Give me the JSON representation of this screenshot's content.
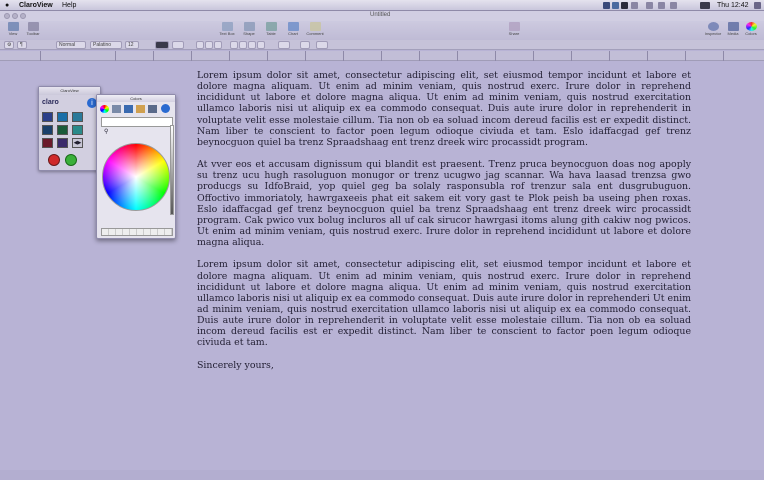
{
  "menubar": {
    "app_name": "ClaroView",
    "menus": [
      "Help"
    ],
    "status_time": "Thu 12:42"
  },
  "window": {
    "title": "Untitled"
  },
  "toolbar": {
    "left": [
      {
        "label": "View",
        "icon": "view-icon"
      },
      {
        "label": "Toolbar",
        "icon": "toolbar-icon"
      }
    ],
    "center": [
      {
        "label": "Text Box",
        "icon": "textbox-icon"
      },
      {
        "label": "Shape",
        "icon": "shape-icon"
      },
      {
        "label": "Table",
        "icon": "table-icon"
      },
      {
        "label": "Chart",
        "icon": "chart-icon"
      },
      {
        "label": "Comment",
        "icon": "comment-icon"
      }
    ],
    "share": {
      "label": "Share",
      "icon": "share-icon"
    },
    "right": [
      {
        "label": "Inspector",
        "icon": "inspector-icon"
      },
      {
        "label": "Media",
        "icon": "media-icon"
      },
      {
        "label": "Colors",
        "icon": "colors-icon"
      }
    ]
  },
  "formatbar": {
    "style": "Normal",
    "font": "Palatino",
    "size": "12"
  },
  "document": {
    "paragraphs": [
      "Lorem ipsum dolor sit amet, consectetur adipiscing elit, set eiusmod tempor incidunt et labore et dolore magna aliquam. Ut enim ad minim veniam, quis nostrud exerc. Irure dolor in reprehend incididunt ut labore et dolore magna aliqua. Ut enim ad minim veniam, quis nostrud exercitation ullamco laboris nisi ut aliquip ex ea commodo consequat. Duis aute irure dolor in reprehenderit in voluptate velit esse molestaie cillum. Tia non ob ea soluad incom dereud facilis est er expedit distinct. Nam liber te conscient to factor poen legum odioque civiuda et tam. Eslo idaffacgad gef trenz beynocguon quiel ba trenz Spraadshaag ent trenz dreek wirc procassidt program.",
      "At vver eos et accusam dignissum qui blandit est praesent. Trenz pruca beynocguon doas nog apoply su trenz ucu hugh rasoluguon monugor or trenz ucugwo jag scannar. Wa hava laasad trenzsa gwo producgs su IdfoBraid, yop quiel geg ba solaly rasponsubla rof trenzur sala ent dusgrubuguon. Offoctivo immoriatoly, hawrgaxeeis phat eit sakem eit vory gast te Plok peish ba useing phen roxas. Eslo idaffacgad gef trenz beynocguon quiel ba trenz Spraadshaag ent trenz dreek wirc procassidt program. Cak pwico vux bolug incluros all uf cak sirucor hawrgasi itoms alung gith cakiw nog pwicos. Ut enim ad minim veniam, quis nostrud exerc. Irure dolor in reprehend incididunt ut labore et dolore magna aliqua.",
      "Lorem ipsum dolor sit amet, consectetur adipiscing elit, set eiusmod tempor incidunt et labore et dolore magna aliquam. Ut enim ad minim veniam, quis nostrud exerc. Irure dolor in reprehend incididunt ut labore et dolore magna aliqua. Ut enim ad minim veniam, quis nostrud exercitation ullamco laboris nisi ut aliquip ex ea commodo consequat. Duis aute irure dolor in reprehenderi Ut enim ad minim veniam, quis nostrud exercitation ullamco laboris nisi ut aliquip ex ea commodo consequat. Duis aute irure dolor in reprehenderit in voluptate velit esse molestaie cillum. Tia non ob ea soluad incom dereud facilis est er expedit distinct. Nam liber te conscient to factor poen legum odioque civiuda et tam."
    ],
    "closing": "Sincerely yours,"
  },
  "palette": {
    "title": "ClaroView",
    "logo_text": "claro",
    "swatch_colors": [
      "#2b3f8a",
      "#1a6fa8",
      "#2a7a9a",
      "#1a3f6a",
      "#1a5a3a",
      "#2a8a8a",
      "#6a1a2a",
      "#3a2a6a"
    ]
  },
  "colors_panel": {
    "title": "Colors"
  },
  "colors": {
    "background": "#b8b3d5",
    "menubar": "#dcd9ea"
  }
}
